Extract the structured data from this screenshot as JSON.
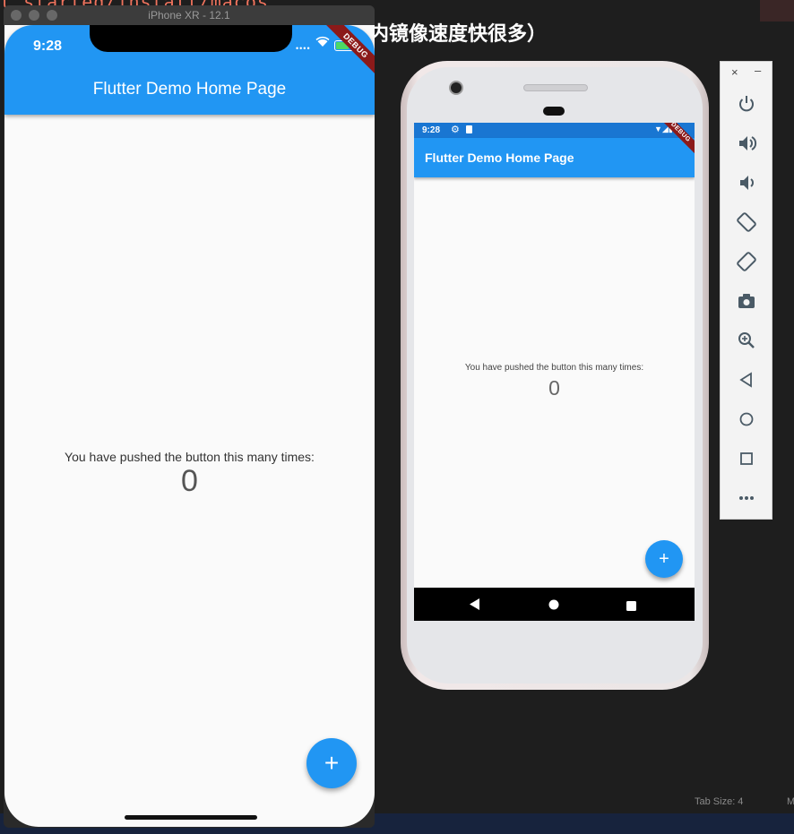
{
  "background": {
    "code_fragment": "t started/install/macos",
    "heading_fragment": "内镜像速度快很多）",
    "tab_size_label": "Tab Size: 4",
    "statusbar_trailing": "M"
  },
  "ios_simulator": {
    "window_title": "iPhone XR - 12.1",
    "status_time": "9:28",
    "app_bar_title": "Flutter Demo Home Page",
    "debug_banner": "DEBUG",
    "message": "You have pushed the button this many times:",
    "counter": "0",
    "fab_label": "+"
  },
  "android_emulator": {
    "status_time": "9:28",
    "app_bar_title": "Flutter Demo Home Page",
    "debug_banner": "DEBUG",
    "message": "You have pushed the button this many times:",
    "counter": "0",
    "fab_label": "+",
    "nav_buttons": [
      "back-icon",
      "home-icon",
      "recents-icon"
    ]
  },
  "emulator_toolbar": {
    "close_label": "×",
    "minimize_label": "–",
    "buttons": [
      "power-icon",
      "volume-up-icon",
      "volume-down-icon",
      "rotate-left-icon",
      "rotate-right-icon",
      "camera-icon",
      "zoom-icon",
      "back-icon",
      "home-icon",
      "overview-icon",
      "more-icon"
    ]
  },
  "colors": {
    "flutter_blue": "#2196f3",
    "android_status_bar": "#1976d2",
    "debug_ribbon": "#8b1a1a",
    "editor_background": "#1e1e1e"
  }
}
